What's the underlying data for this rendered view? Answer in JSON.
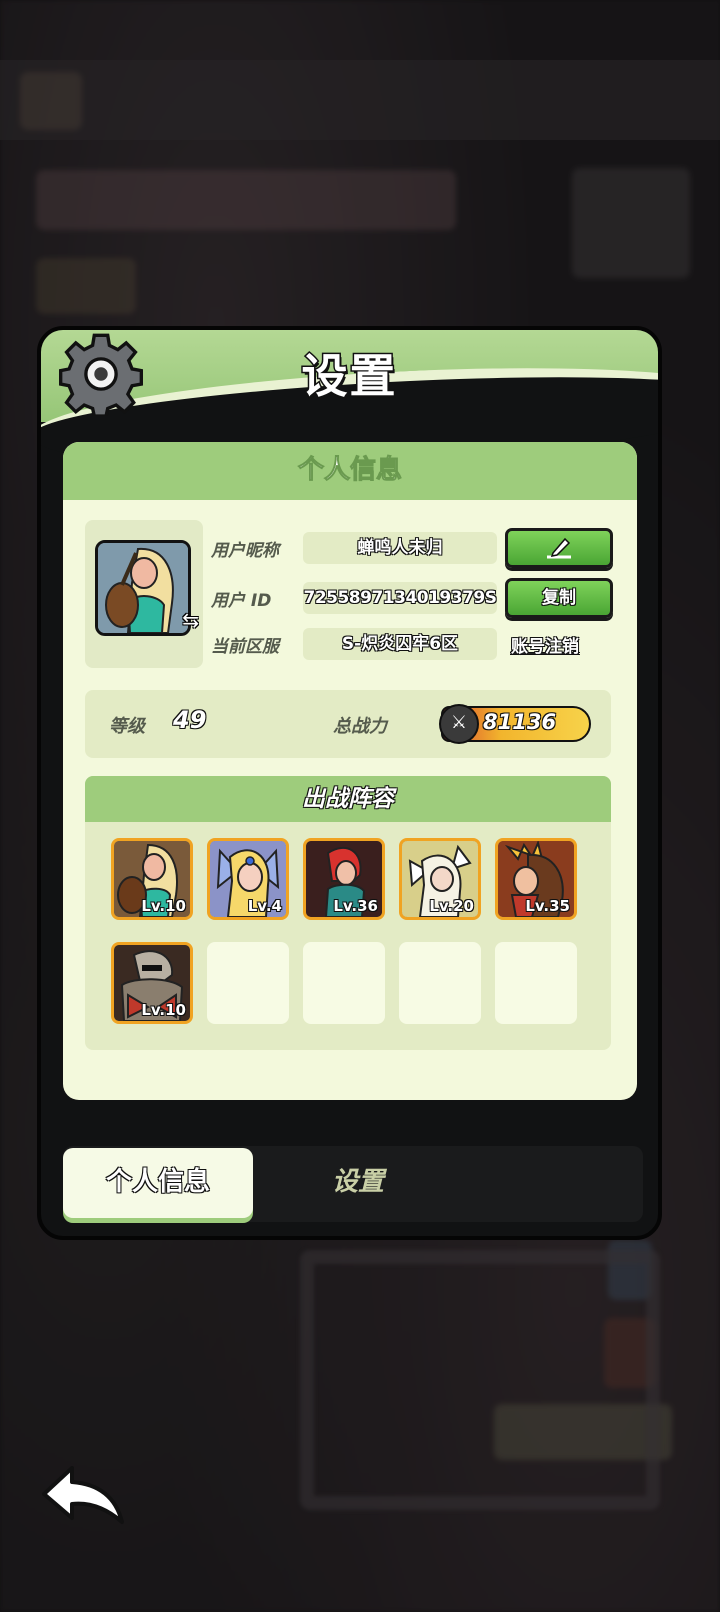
{
  "panel": {
    "title": "设置",
    "personal_header": "个人信息"
  },
  "profile": {
    "nickname_label": "用户昵称",
    "nickname": "蝉鸣人未归",
    "id_label": "用户  ID",
    "user_id": "7255897134019379S",
    "server_label": "当前区服",
    "server": "S-炽炎囚牢6区",
    "copy_label": "复制",
    "cancel_account_label": "账号注销"
  },
  "stats": {
    "level_label": "等级",
    "level": "49",
    "power_label": "总战力",
    "power": "81136"
  },
  "lineup": {
    "title": "出战阵容",
    "heroes": [
      {
        "level": "Lv.10",
        "color": "#6b4a2a"
      },
      {
        "level": "Lv.4",
        "color": "#5a6aa8"
      },
      {
        "level": "Lv.36",
        "color": "#7a2a22"
      },
      {
        "level": "Lv.20",
        "color": "#d6c26a"
      },
      {
        "level": "Lv.35",
        "color": "#8a3a1e"
      },
      {
        "level": "Lv.10",
        "color": "#4a3a2e"
      }
    ]
  },
  "tabs": {
    "personal": "个人信息",
    "settings": "设置"
  },
  "colors": {
    "header_green": "#9ecc7c",
    "card_bg": "#f3f9dc",
    "button_green": "#5fbb3f",
    "panel_dark": "#111213"
  }
}
